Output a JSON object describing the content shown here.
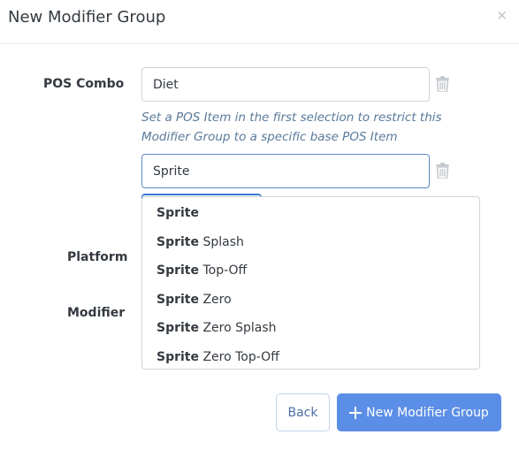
{
  "modal": {
    "title": "New Modifier Group",
    "close_glyph": "×"
  },
  "form": {
    "pos_combo_label": "POS Combo",
    "platform_label": "Platform",
    "modifier_label": "Modifier",
    "pos_inputs": [
      {
        "value": "Diet"
      },
      {
        "value": "Sprite"
      }
    ],
    "help_text": "Set a POS Item in the first selection to restrict this Modifier Group to a specific base POS Item"
  },
  "dropdown": {
    "match_text": "Sprite",
    "options": [
      {
        "match": "Sprite",
        "rest": ""
      },
      {
        "match": "Sprite",
        "rest": " Splash"
      },
      {
        "match": "Sprite",
        "rest": " Top-Off"
      },
      {
        "match": "Sprite",
        "rest": " Zero"
      },
      {
        "match": "Sprite",
        "rest": " Zero Splash"
      },
      {
        "match": "Sprite",
        "rest": " Zero Top-Off"
      }
    ]
  },
  "footer": {
    "back_label": "Back",
    "new_group_label": "New Modifier Group"
  },
  "colors": {
    "primary": "#5b8ee6",
    "focus_border": "#5b8ac8",
    "help_text": "#5a7a9a"
  },
  "icons": [
    "close-icon",
    "trash-icon",
    "plus-icon"
  ]
}
